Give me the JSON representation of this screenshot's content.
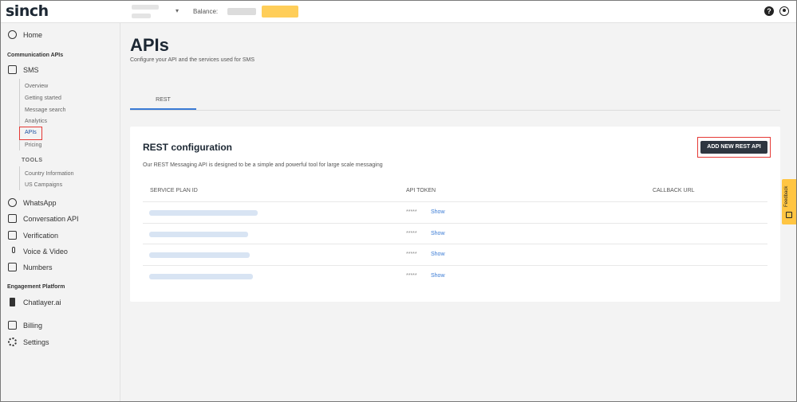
{
  "topbar": {
    "logo": "sinch",
    "account_caret": "▾",
    "balance_label": "Balance:",
    "help_icon": "?"
  },
  "sidebar": {
    "home": "Home",
    "communication_apis_title": "Communication APIs",
    "sms": "SMS",
    "sms_sub": [
      "Overview",
      "Getting started",
      "Message search",
      "Analytics",
      "APIs",
      "Pricing"
    ],
    "tools_title": "TOOLS",
    "tools_sub": [
      "Country Information",
      "US Campaigns"
    ],
    "whatsapp": "WhatsApp",
    "conversation_api": "Conversation API",
    "verification": "Verification",
    "voice_video": "Voice & Video",
    "numbers": "Numbers",
    "engagement_title": "Engagement Platform",
    "chatlayer": "Chatlayer.ai",
    "billing": "Billing",
    "settings": "Settings"
  },
  "main": {
    "title": "APIs",
    "subtitle": "Configure your API and the services used for SMS",
    "tab_rest": "REST"
  },
  "card": {
    "title": "REST configuration",
    "description": "Our REST Messaging API is designed to be a simple and powerful tool for large scale messaging",
    "add_button": "ADD NEW REST API",
    "columns": [
      "SERVICE PLAN ID",
      "API TOKEN",
      "CALLBACK URL"
    ],
    "rows": [
      {
        "token_mask": "*****",
        "show": "Show"
      },
      {
        "token_mask": "*****",
        "show": "Show"
      },
      {
        "token_mask": "*****",
        "show": "Show"
      },
      {
        "token_mask": "*****",
        "show": "Show"
      }
    ]
  },
  "feedback": {
    "label": "Feedback"
  },
  "colors": {
    "accent": "#3a7bd5",
    "brand_dark": "#1c2733",
    "highlight": "#e53935",
    "feedback_bg": "#ffc542"
  }
}
